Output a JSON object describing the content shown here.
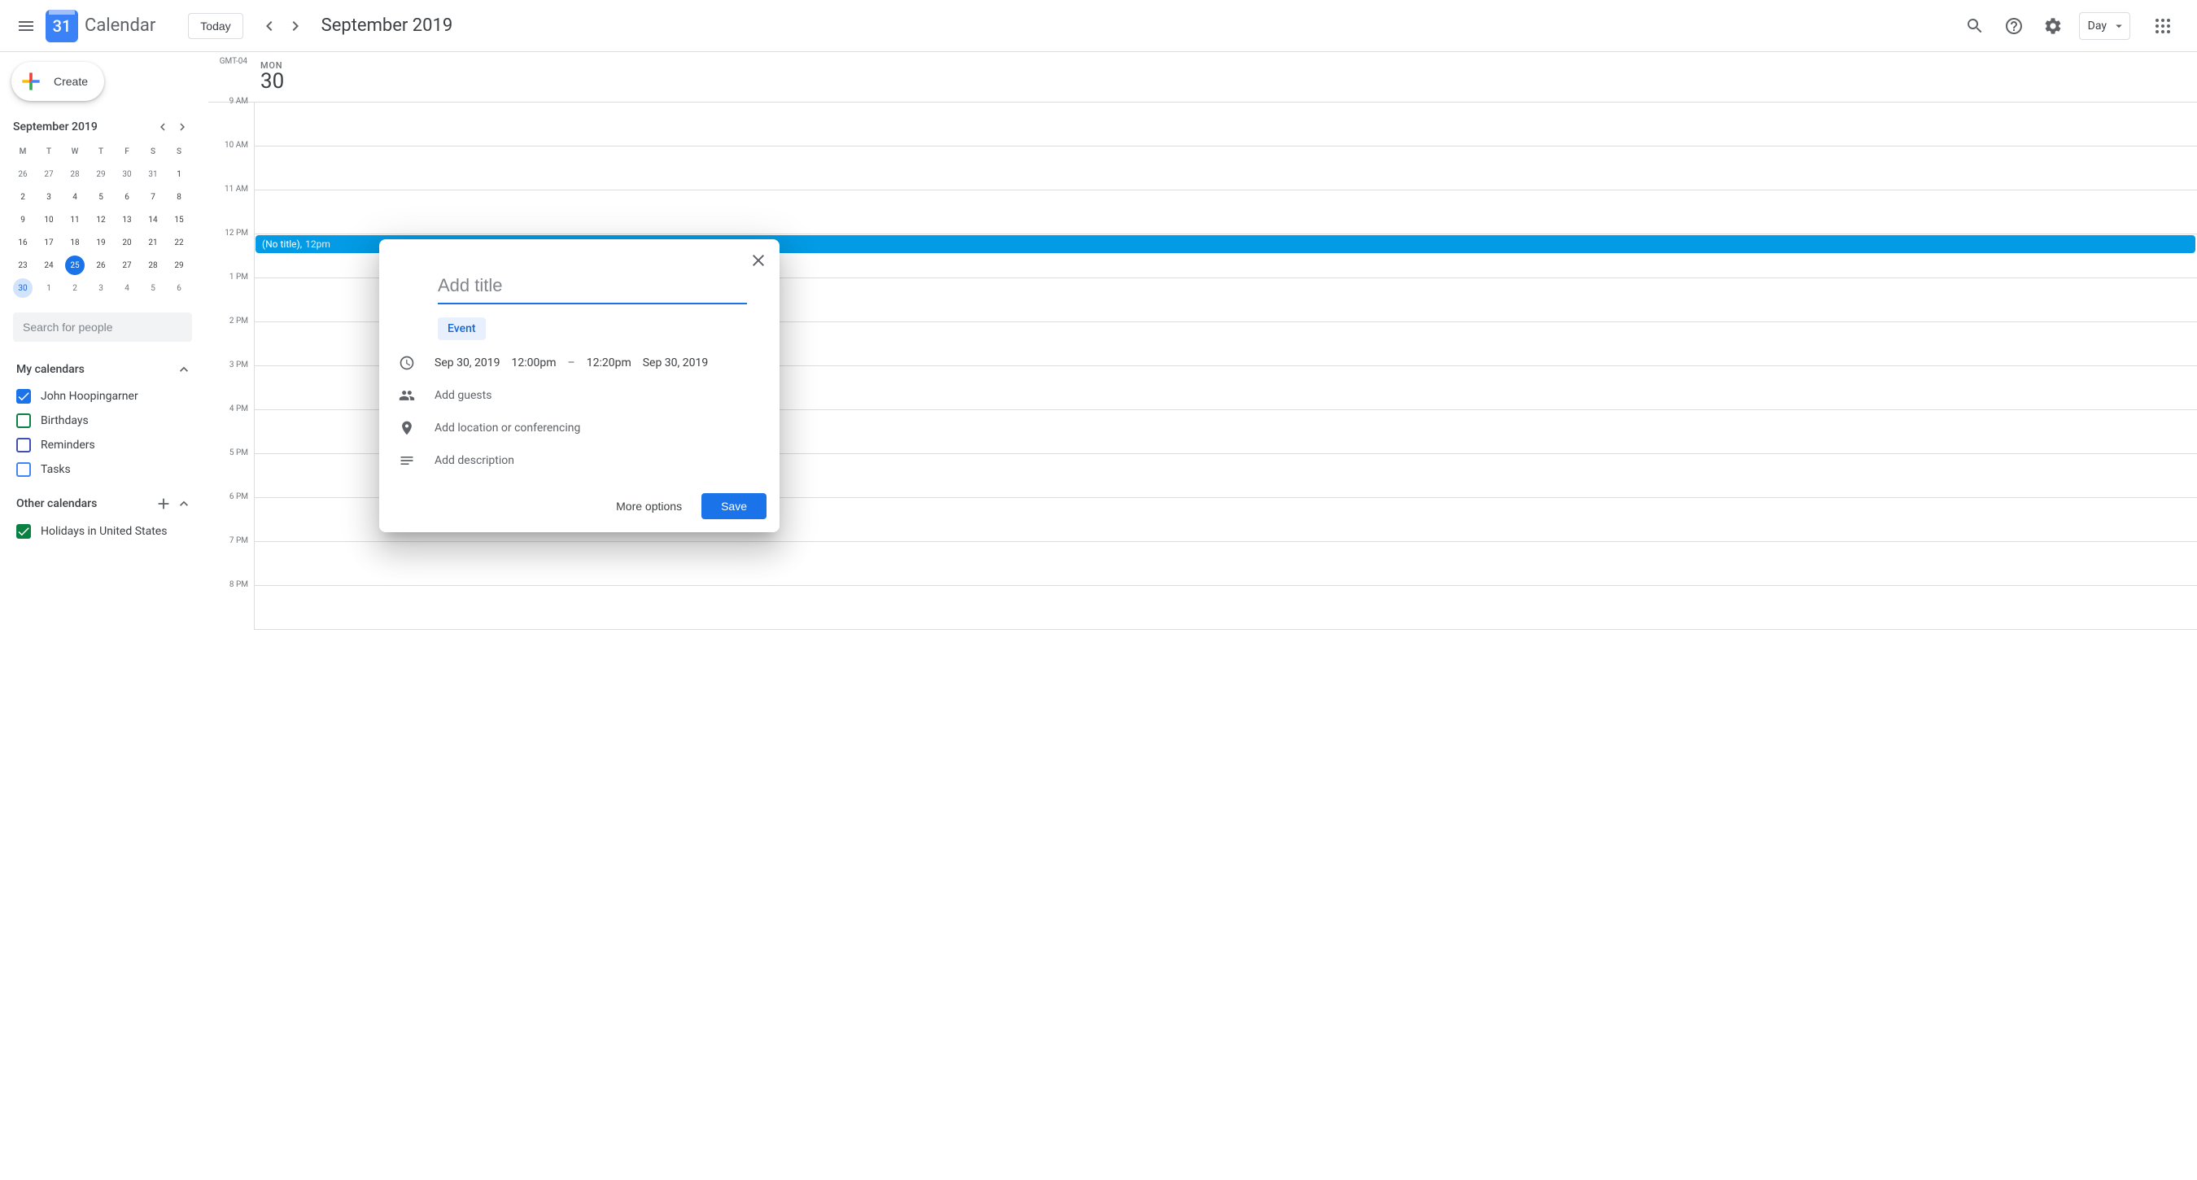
{
  "header": {
    "logo_number": "31",
    "app_name": "Calendar",
    "today_label": "Today",
    "current_period": "September 2019",
    "view_label": "Day"
  },
  "sidebar": {
    "create_label": "Create",
    "mini_month": "September 2019",
    "weekday_headers": [
      "M",
      "T",
      "W",
      "T",
      "F",
      "S",
      "S"
    ],
    "mini_weeks": [
      [
        {
          "d": "26",
          "o": true
        },
        {
          "d": "27",
          "o": true
        },
        {
          "d": "28",
          "o": true
        },
        {
          "d": "29",
          "o": true
        },
        {
          "d": "30",
          "o": true
        },
        {
          "d": "31",
          "o": true
        },
        {
          "d": "1"
        }
      ],
      [
        {
          "d": "2"
        },
        {
          "d": "3"
        },
        {
          "d": "4"
        },
        {
          "d": "5"
        },
        {
          "d": "6"
        },
        {
          "d": "7"
        },
        {
          "d": "8"
        }
      ],
      [
        {
          "d": "9"
        },
        {
          "d": "10"
        },
        {
          "d": "11"
        },
        {
          "d": "12"
        },
        {
          "d": "13"
        },
        {
          "d": "14"
        },
        {
          "d": "15"
        }
      ],
      [
        {
          "d": "16"
        },
        {
          "d": "17"
        },
        {
          "d": "18"
        },
        {
          "d": "19"
        },
        {
          "d": "20"
        },
        {
          "d": "21"
        },
        {
          "d": "22"
        }
      ],
      [
        {
          "d": "23"
        },
        {
          "d": "24"
        },
        {
          "d": "25",
          "today": true
        },
        {
          "d": "26"
        },
        {
          "d": "27"
        },
        {
          "d": "28"
        },
        {
          "d": "29"
        }
      ],
      [
        {
          "d": "30",
          "sel": true
        },
        {
          "d": "1",
          "o": true
        },
        {
          "d": "2",
          "o": true
        },
        {
          "d": "3",
          "o": true
        },
        {
          "d": "4",
          "o": true
        },
        {
          "d": "5",
          "o": true
        },
        {
          "d": "6",
          "o": true
        }
      ]
    ],
    "search_placeholder": "Search for people",
    "my_calendars_label": "My calendars",
    "other_calendars_label": "Other calendars",
    "my_calendars": [
      {
        "name": "John Hoopingarner",
        "color": "#1a73e8",
        "checked": true
      },
      {
        "name": "Birthdays",
        "color": "#0b8043",
        "checked": false
      },
      {
        "name": "Reminders",
        "color": "#3f51b5",
        "checked": false
      },
      {
        "name": "Tasks",
        "color": "#4285f4",
        "checked": false
      }
    ],
    "other_cals": [
      {
        "name": "Holidays in United States",
        "color": "#0b8043",
        "checked": true
      }
    ]
  },
  "day": {
    "tz": "GMT-04",
    "dow": "MON",
    "daynum": "30",
    "hours": [
      "9 AM",
      "10 AM",
      "11 AM",
      "12 PM",
      "1 PM",
      "2 PM",
      "3 PM",
      "4 PM",
      "5 PM",
      "6 PM",
      "7 PM",
      "8 PM"
    ],
    "event": {
      "title": "(No title)",
      "time": "12pm"
    }
  },
  "popup": {
    "title_placeholder": "Add title",
    "tab_event": "Event",
    "start_date": "Sep 30, 2019",
    "start_time": "12:00pm",
    "end_time": "12:20pm",
    "end_date": "Sep 30, 2019",
    "add_guests": "Add guests",
    "add_location": "Add location or conferencing",
    "add_description": "Add description",
    "more_options": "More options",
    "save": "Save"
  }
}
